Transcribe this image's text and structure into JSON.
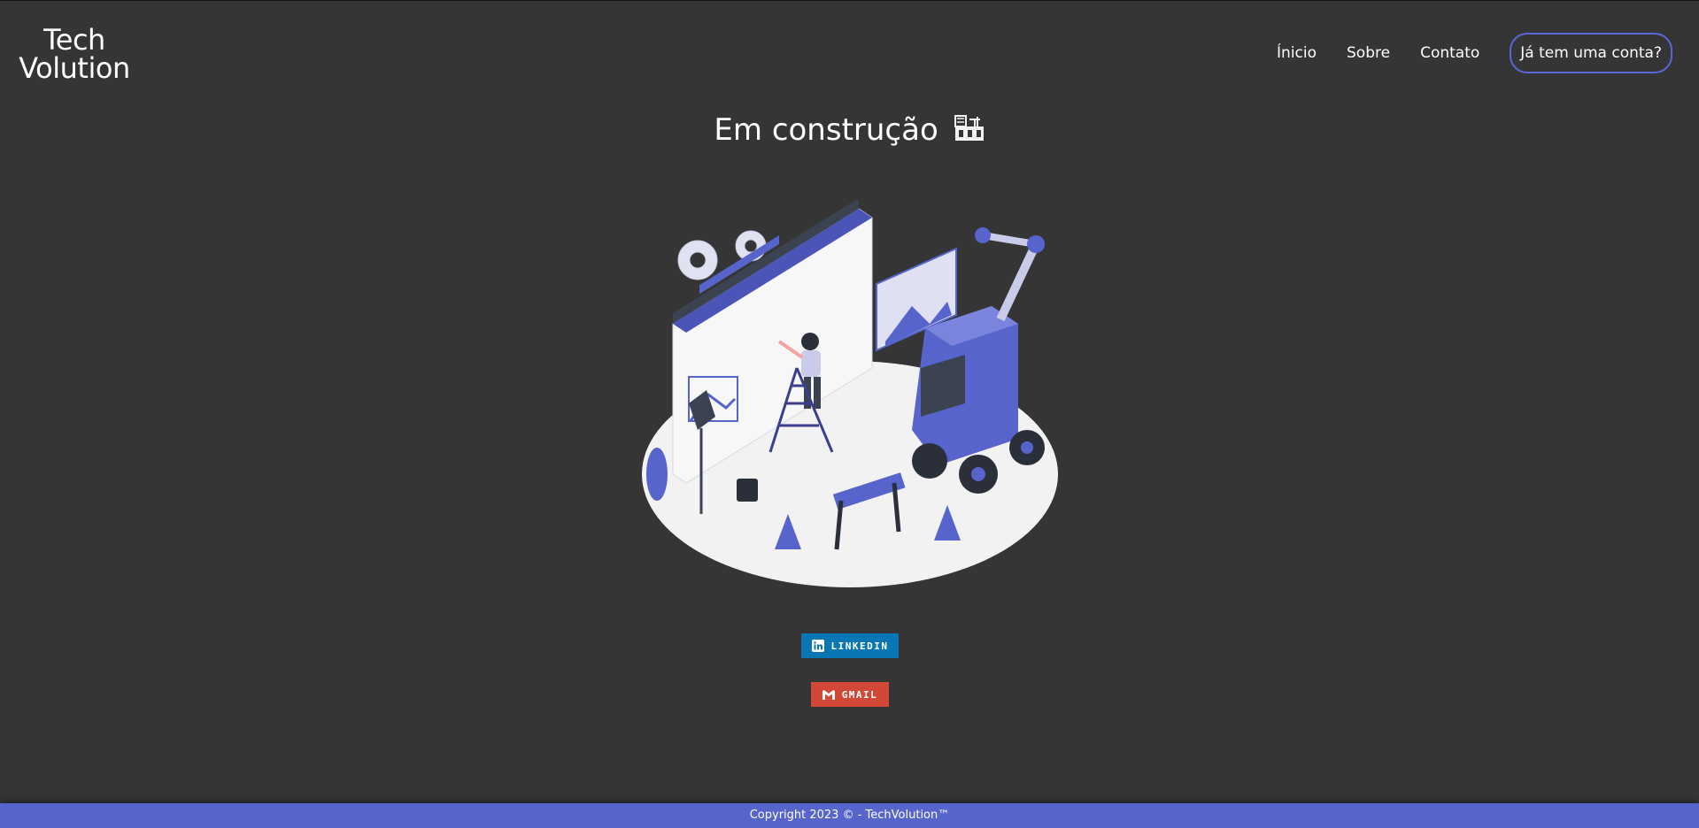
{
  "header": {
    "logo_line1": "Tech",
    "logo_line2": "Volution",
    "nav": {
      "inicio": "Ínicio",
      "sobre": "Sobre",
      "contato": "Contato"
    },
    "account_button": "Já tem uma conta?"
  },
  "main": {
    "title": "Em construção",
    "title_icon": "construction-icon",
    "illustration": "under-construction-illustration"
  },
  "badges": {
    "linkedin": {
      "label": "LINKEDIN",
      "icon": "linkedin-icon",
      "color": "#0a77b5"
    },
    "gmail": {
      "label": "GMAIL",
      "icon": "gmail-icon",
      "color": "#d14836"
    }
  },
  "footer": {
    "copyright": "Copyright 2023 © - TechVolution™"
  },
  "colors": {
    "background": "#353535",
    "accent": "#5664cc"
  }
}
